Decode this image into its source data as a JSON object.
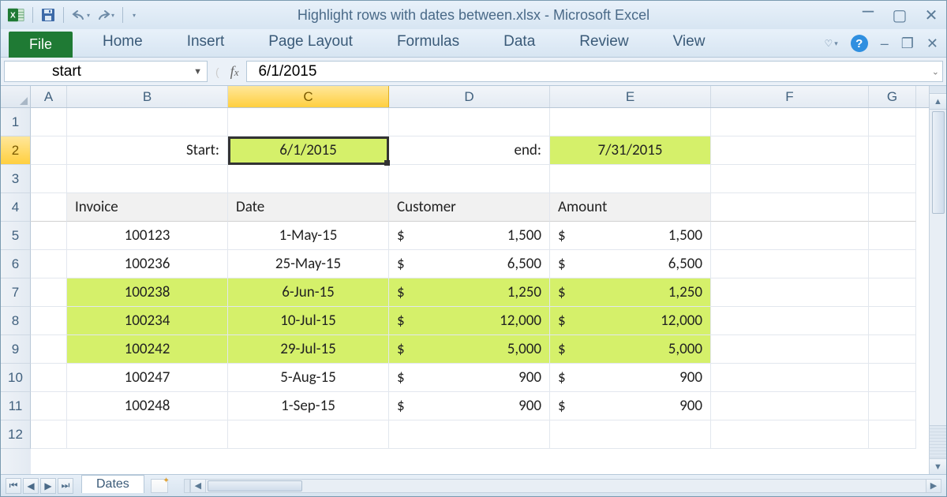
{
  "title": "Highlight rows with dates between.xlsx - Microsoft Excel",
  "ribbon": {
    "file": "File",
    "tabs": [
      "Home",
      "Insert",
      "Page Layout",
      "Formulas",
      "Data",
      "Review",
      "View"
    ]
  },
  "namebox": "start",
  "formula": "6/1/2015",
  "columns": [
    "A",
    "B",
    "C",
    "D",
    "E",
    "F",
    "G"
  ],
  "active_col_index": 2,
  "rows": [
    "1",
    "2",
    "3",
    "4",
    "5",
    "6",
    "7",
    "8",
    "9",
    "10",
    "11",
    "12"
  ],
  "active_row_index": 1,
  "labels": {
    "start": "Start:",
    "end": "end:"
  },
  "inputs": {
    "start_date": "6/1/2015",
    "end_date": "7/31/2015"
  },
  "table": {
    "headers": [
      "Invoice",
      "Date",
      "Customer",
      "Amount"
    ],
    "rows": [
      {
        "invoice": "100123",
        "date": "1-May-15",
        "customer": "1,500",
        "amount": "1,500",
        "hl": false
      },
      {
        "invoice": "100236",
        "date": "25-May-15",
        "customer": "6,500",
        "amount": "6,500",
        "hl": false
      },
      {
        "invoice": "100238",
        "date": "6-Jun-15",
        "customer": "1,250",
        "amount": "1,250",
        "hl": true
      },
      {
        "invoice": "100234",
        "date": "10-Jul-15",
        "customer": "12,000",
        "amount": "12,000",
        "hl": true
      },
      {
        "invoice": "100242",
        "date": "29-Jul-15",
        "customer": "5,000",
        "amount": "5,000",
        "hl": true
      },
      {
        "invoice": "100247",
        "date": "5-Aug-15",
        "customer": "900",
        "amount": "900",
        "hl": false
      },
      {
        "invoice": "100248",
        "date": "1-Sep-15",
        "customer": "900",
        "amount": "900",
        "hl": false
      }
    ]
  },
  "sheet_tab": "Dates",
  "currency": "$"
}
